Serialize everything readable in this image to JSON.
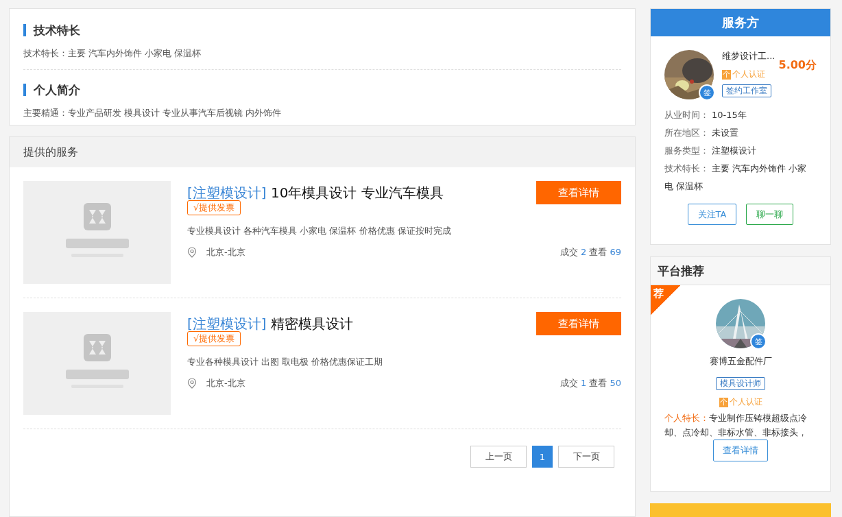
{
  "profile_sections": [
    {
      "title": "技术特长",
      "text": "技术特长：主要 汽车内外饰件 小家电 保温杯"
    },
    {
      "title": "个人简介",
      "text": "主要精通：专业产品研发 模具设计 专业从事汽车后视镜 内外饰件"
    }
  ],
  "services": {
    "title": "提供的服务",
    "items": [
      {
        "kind": "picture",
        "category": "[注塑模设计]",
        "title": "10年模具设计 专业汽车模具",
        "badge": "√提供发票",
        "description": "专业模具设计 各种汽车模具 小家电 保温杯 价格优惠 保证按时完成",
        "location": "北京-北京",
        "deals_label": "成交",
        "deals": "2",
        "views_label": "查看",
        "views": "69",
        "button": "查看详情"
      },
      {
        "kind": "picture",
        "category": "[注塑模设计]",
        "title": "精密模具设计",
        "badge": "√提供发票",
        "description": "专业各种模具设计 出图 取电极 价格优惠保证工期",
        "location": "北京-北京",
        "deals_label": "成交",
        "deals": "1",
        "views_label": "查看",
        "views": "50",
        "button": "查看详情"
      }
    ]
  },
  "pagination": {
    "prev": "上一页",
    "pages": [
      {
        "label": "1",
        "selected": true
      }
    ],
    "next": "下一页"
  },
  "provider": {
    "title": "服务方",
    "sign_badge": "签",
    "name": "维梦设计工...",
    "score": "5.00分",
    "cert_icon": "个",
    "cert": "个人认证",
    "tag": "签约工作室",
    "info": [
      {
        "label": "从业时间：",
        "value": "10-15年"
      },
      {
        "label": "所在地区：",
        "value": "未设置"
      },
      {
        "label": "服务类型：",
        "value": "注塑模设计"
      },
      {
        "label": "技术特长：",
        "value": "主要 汽车内外饰件 小家电 保温杯"
      }
    ],
    "buttons": [
      {
        "label": "关注TA",
        "color": "#3a8fd8"
      },
      {
        "label": "聊一聊",
        "color": "#2aa84a"
      }
    ]
  },
  "recommend": {
    "title": "平台推荐",
    "corner": "荐",
    "sign_badge": "签",
    "name": "赛博五金配件厂",
    "tag": "模具设计师",
    "cert_icon": "个",
    "cert": "个人认证",
    "specialty_label": "个人特长：",
    "specialty": "专业制作压铸模超级点冷却、点冷却、非标水管、非标接头，",
    "button": "查看详情"
  }
}
